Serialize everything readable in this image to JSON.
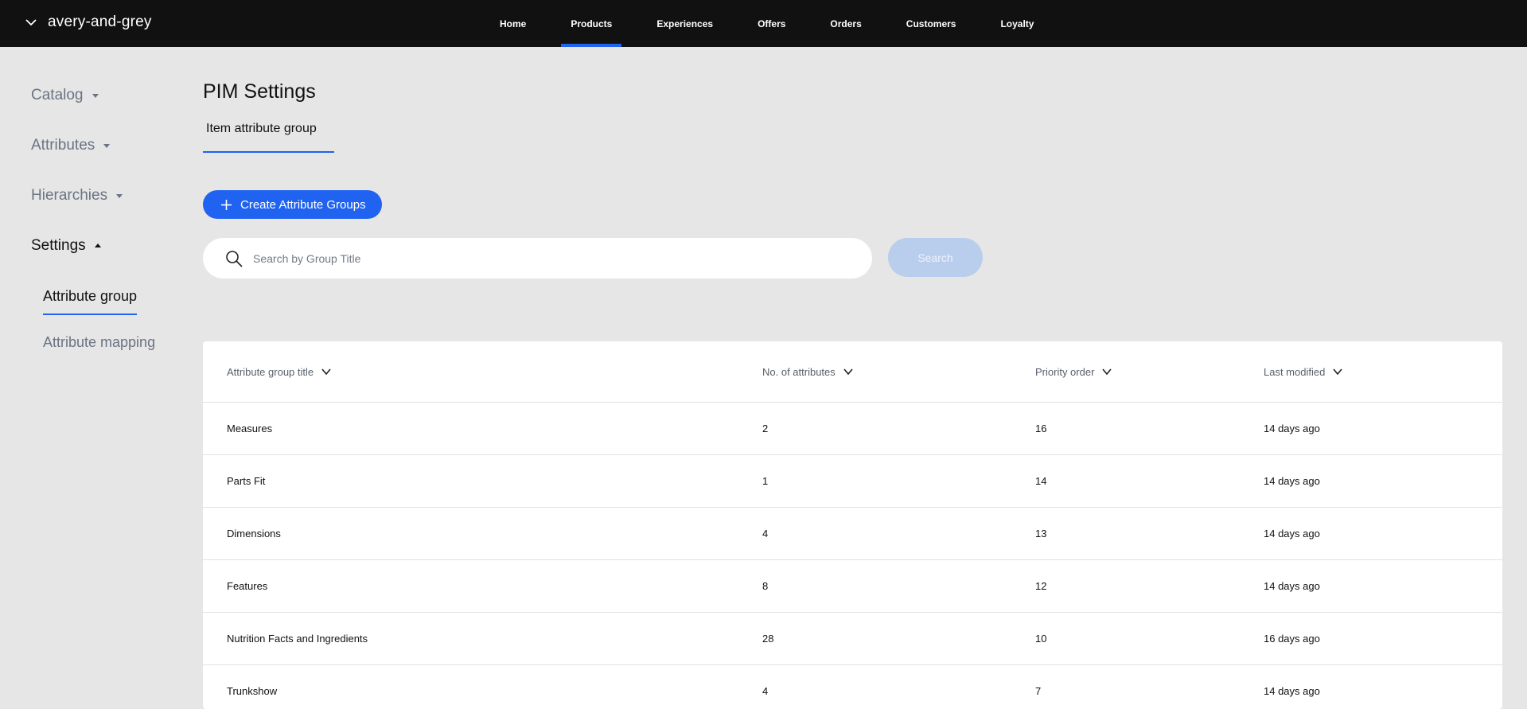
{
  "org": {
    "name": "avery-and-grey"
  },
  "nav": {
    "items": [
      {
        "label": "Home",
        "active": false
      },
      {
        "label": "Products",
        "active": true
      },
      {
        "label": "Experiences",
        "active": false
      },
      {
        "label": "Offers",
        "active": false
      },
      {
        "label": "Orders",
        "active": false
      },
      {
        "label": "Customers",
        "active": false
      },
      {
        "label": "Loyalty",
        "active": false
      }
    ],
    "accent_color": "#1f63f0"
  },
  "sidebar": {
    "groups": [
      {
        "label": "Catalog",
        "expanded": false
      },
      {
        "label": "Attributes",
        "expanded": false
      },
      {
        "label": "Hierarchies",
        "expanded": false
      },
      {
        "label": "Settings",
        "expanded": true
      }
    ],
    "sub_items": [
      {
        "label": "Attribute group",
        "active": true
      },
      {
        "label": "Attribute mapping",
        "active": false
      }
    ]
  },
  "main": {
    "title": "PIM Settings",
    "tab_label": "Item attribute group",
    "create_button_label": "Create Attribute Groups",
    "search": {
      "placeholder": "Search by Group Title",
      "value": "",
      "button_label": "Search"
    }
  },
  "table": {
    "columns": [
      "Attribute group title",
      "No. of attributes",
      "Priority order",
      "Last modified"
    ],
    "rows": [
      {
        "title": "Measures",
        "count": "2",
        "priority": "16",
        "modified": "14 days ago"
      },
      {
        "title": "Parts Fit",
        "count": "1",
        "priority": "14",
        "modified": "14 days ago"
      },
      {
        "title": "Dimensions",
        "count": "4",
        "priority": "13",
        "modified": "14 days ago"
      },
      {
        "title": "Features",
        "count": "8",
        "priority": "12",
        "modified": "14 days ago"
      },
      {
        "title": "Nutrition Facts and Ingredients",
        "count": "28",
        "priority": "10",
        "modified": "16 days ago"
      },
      {
        "title": "Trunkshow",
        "count": "4",
        "priority": "7",
        "modified": "14 days ago"
      }
    ]
  }
}
